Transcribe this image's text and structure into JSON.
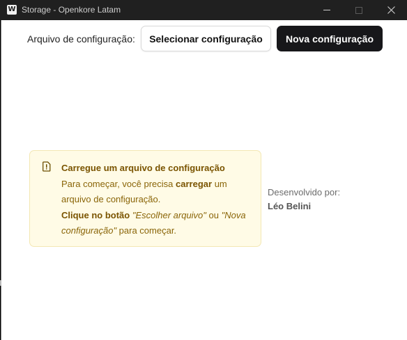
{
  "window": {
    "logo_letter": "W",
    "title": "Storage - Openkore Latam",
    "controls": {
      "minimize": "minimize-icon",
      "maximize": "maximize-icon",
      "close": "close-icon"
    }
  },
  "config_bar": {
    "label": "Arquivo de configuração:",
    "select_button": "Selecionar configuração",
    "new_button": "Nova configuração"
  },
  "alert": {
    "icon": "file-alert-icon",
    "title": "Carregue um arquivo de configuração",
    "line1_prefix": "Para começar, você precisa ",
    "line1_strong": "carregar",
    "line1_suffix": " um arquivo de configuração.",
    "line2_strong": "Clique no botão",
    "line2_em1": "\"Escolher arquivo\"",
    "line2_mid": " ou ",
    "line2_em2": "\"Nova configuração\"",
    "line2_suffix": " para começar.",
    "colors": {
      "background": "#fffbe6",
      "border": "#f3e7b3",
      "text": "#8a6508"
    }
  },
  "credits": {
    "label": "Desenvolvido por:",
    "author": "Léo Belini"
  }
}
